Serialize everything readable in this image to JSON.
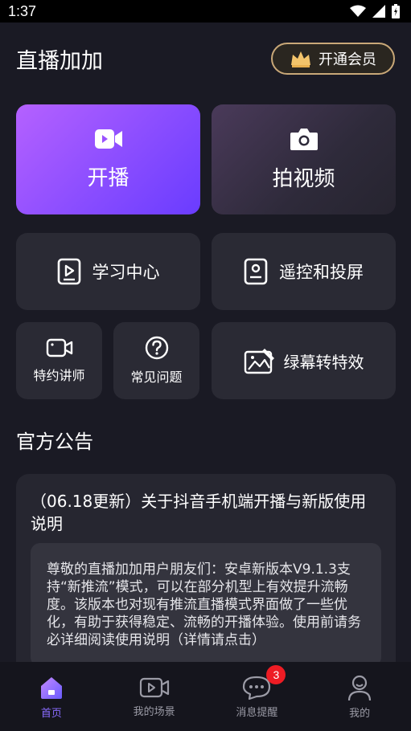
{
  "status": {
    "time": "1:37"
  },
  "header": {
    "title": "直播加加",
    "vip_label": "开通会员"
  },
  "cards": {
    "live": "开播",
    "video": "拍视频",
    "learn": "学习中心",
    "remote": "遥控和投屏",
    "lecturer": "特约讲师",
    "faq": "常见问题",
    "greenscreen": "绿幕转特效"
  },
  "announcements": {
    "title": "官方公告",
    "item_title": "（06.18更新）关于抖音手机端开播与新版使用说明",
    "item_body": "尊敬的直播加加用户朋友们：安卓新版本V9.1.3支持“新推流”模式，可以在部分机型上有效提升流畅度。该版本也对现有推流直播模式界面做了一些优化，有助于获得稳定、流畅的开播体验。使用前请务必详细阅读使用说明（详情请点击）"
  },
  "tabs": [
    {
      "label": "首页"
    },
    {
      "label": "我的场景"
    },
    {
      "label": "消息提醒",
      "badge": "3"
    },
    {
      "label": "我的"
    }
  ],
  "colors": {
    "accent": "#8a6cff",
    "gold": "#c9a878",
    "badge": "#ee1c24"
  }
}
